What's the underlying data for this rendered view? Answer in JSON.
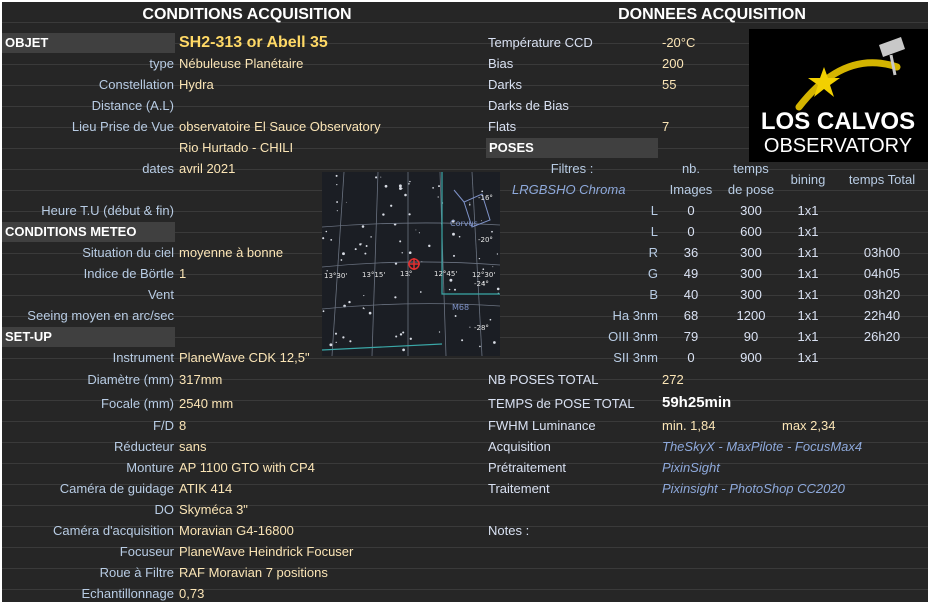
{
  "headers": {
    "left": "CONDITIONS ACQUISITION",
    "right": "DONNEES ACQUISITION"
  },
  "objet": {
    "label": "OBJET",
    "value": "SH2-313 or Abell 35"
  },
  "left_rows": [
    {
      "label": "type",
      "value": "Nébuleuse Planétaire"
    },
    {
      "label": "Constellation",
      "value": "Hydra"
    },
    {
      "label": "Distance (A.L)",
      "value": ""
    },
    {
      "label": "Lieu Prise de Vue",
      "value": "observatoire El Sauce Observatory"
    },
    {
      "label": "",
      "value": "Rio Hurtado - CHILI"
    },
    {
      "label": "dates",
      "value": "avril 2021"
    },
    {
      "label": "",
      "value": ""
    },
    {
      "label": "Heure T.U (début & fin)",
      "value": ""
    }
  ],
  "meteo": {
    "title": "CONDITIONS METEO",
    "rows": [
      {
        "label": "Situation du ciel",
        "value": "moyenne à bonne"
      },
      {
        "label": "Indice de Börtle",
        "value": "1"
      },
      {
        "label": "Vent",
        "value": ""
      },
      {
        "label": "Seeing moyen en arc/sec",
        "value": ""
      }
    ]
  },
  "setup": {
    "title": "SET-UP",
    "rows": [
      {
        "label": "Instrument",
        "value": "PlaneWave CDK 12,5\""
      },
      {
        "label": "Diamètre (mm)",
        "value": "317mm"
      },
      {
        "label": "Focale (mm)",
        "value": "2540 mm"
      },
      {
        "label": "F/D",
        "value": "8"
      },
      {
        "label": "Réducteur",
        "value": "sans"
      },
      {
        "label": "Monture",
        "value": "AP 1100 GTO with CP4"
      },
      {
        "label": "Caméra de guidage",
        "value": "ATIK 414"
      },
      {
        "label": "DO",
        "value": "Skyméca 3\""
      },
      {
        "label": "Caméra d'acquisition",
        "value": "Moravian G4-16800"
      },
      {
        "label": "Focuseur",
        "value": "PlaneWave Heindrick Focuser"
      },
      {
        "label": "Roue à Filtre",
        "value": "RAF Moravian 7 positions"
      },
      {
        "label": "Echantillonnage",
        "value": "0,73"
      }
    ]
  },
  "acq_rows": [
    {
      "label": "Température CCD",
      "value": "-20°C"
    },
    {
      "label": "Bias",
      "value": "200"
    },
    {
      "label": "Darks",
      "value": "55"
    },
    {
      "label": "Darks de Bias",
      "value": ""
    },
    {
      "label": "Flats",
      "value": "7"
    }
  ],
  "poses": {
    "title": "POSES",
    "filters_label": "Filtres :",
    "filters_name": "LRGBSHO Chroma",
    "col_nb_line1": "nb.",
    "col_nb_line2": "Images",
    "col_temps_line1": "temps",
    "col_temps_line2": "de pose",
    "col_bining": "bining",
    "col_total": "temps Total",
    "rows": [
      {
        "filter": "L",
        "nb": "0",
        "temps": "300",
        "bin": "1x1",
        "total": ""
      },
      {
        "filter": "L",
        "nb": "0",
        "temps": "600",
        "bin": "1x1",
        "total": ""
      },
      {
        "filter": "R",
        "nb": "36",
        "temps": "300",
        "bin": "1x1",
        "total": "03h00"
      },
      {
        "filter": "G",
        "nb": "49",
        "temps": "300",
        "bin": "1x1",
        "total": "04h05"
      },
      {
        "filter": "B",
        "nb": "40",
        "temps": "300",
        "bin": "1x1",
        "total": "03h20"
      },
      {
        "filter": "Ha 3nm",
        "nb": "68",
        "temps": "1200",
        "bin": "1x1",
        "total": "22h40"
      },
      {
        "filter": "OIII 3nm",
        "nb": "79",
        "temps": "90",
        "bin": "1x1",
        "total": "26h20"
      },
      {
        "filter": "SII 3nm",
        "nb": "0",
        "temps": "900",
        "bin": "1x1",
        "total": ""
      }
    ]
  },
  "totals": {
    "nb_label": "NB POSES TOTAL",
    "nb_value": "272",
    "temps_label": "TEMPS de POSE TOTAL",
    "temps_value": "59h25min",
    "fwhm_label": "FWHM Luminance",
    "fwhm_min": "min. 1,84",
    "fwhm_max": "max 2,34",
    "acq_label": "Acquisition",
    "acq_value": "TheSkyX - MaxPilote - FocusMax4",
    "pre_label": "Prétraitement",
    "pre_value": "PixinSight",
    "trait_label": "Traitement",
    "trait_value": "Pixinsight - PhotoShop CC2020",
    "notes_label": "Notes :"
  },
  "logo": {
    "line1": "LOS CALVOS",
    "line2": "OBSERVATORY"
  },
  "chart": {
    "corvus_label": "Corvus",
    "m68_label": "M68",
    "ra_labels": [
      "13°30'",
      "13°15'",
      "13°",
      "12°45'",
      "12°30'"
    ],
    "dec_labels": [
      "-16°",
      "-20°",
      "-24°",
      "-28°"
    ]
  },
  "colors": {
    "background": "#262626",
    "label": "#b8cce4",
    "value": "#fbe5b6",
    "title": "#ffd966",
    "section": "#404040"
  }
}
